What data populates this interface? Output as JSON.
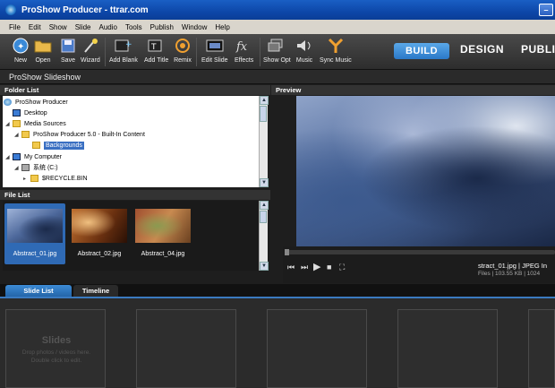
{
  "window": {
    "title": "ProShow Producer - ttrar.com"
  },
  "menu": [
    "File",
    "Edit",
    "Show",
    "Slide",
    "Audio",
    "Tools",
    "Publish",
    "Window",
    "Help"
  ],
  "toolbar": [
    {
      "label": "New",
      "icon": "new-icon"
    },
    {
      "label": "Open",
      "icon": "open-folder-icon"
    },
    {
      "label": "Save",
      "icon": "save-icon"
    },
    {
      "label": "Wizard",
      "icon": "wizard-icon"
    },
    {
      "label": "Add Blank",
      "icon": "add-blank-icon"
    },
    {
      "label": "Add Title",
      "icon": "add-title-icon"
    },
    {
      "label": "Remix",
      "icon": "remix-icon"
    },
    {
      "label": "Edit Slide",
      "icon": "edit-slide-icon"
    },
    {
      "label": "Effects",
      "icon": "effects-icon"
    },
    {
      "label": "Show Opt",
      "icon": "show-options-icon"
    },
    {
      "label": "Music",
      "icon": "music-icon"
    },
    {
      "label": "Sync Music",
      "icon": "sync-music-icon"
    }
  ],
  "modes": {
    "build": "BUILD",
    "design": "DESIGN",
    "publish": "PUBLIS"
  },
  "project": {
    "name": "ProShow Slideshow"
  },
  "folder_list": {
    "header": "Folder List",
    "items": [
      {
        "label": "ProShow Producer",
        "icon": "globe-icon"
      },
      {
        "label": "Desktop",
        "icon": "desktop-icon"
      },
      {
        "label": "Media Sources",
        "icon": "media-sources-icon"
      },
      {
        "label": "ProShow Producer 5.0 - Built-In Content",
        "icon": "folder-icon"
      },
      {
        "label": "Backgrounds",
        "icon": "folder-icon",
        "selected": true
      },
      {
        "label": "My Computer",
        "icon": "computer-icon"
      },
      {
        "label": "系统 (C:)",
        "icon": "disk-icon"
      },
      {
        "label": "$RECYCLE.BIN",
        "icon": "folder-icon"
      }
    ]
  },
  "file_list": {
    "header": "File List",
    "files": [
      {
        "name": "Abstract_01.jpg",
        "selected": true
      },
      {
        "name": "Abstract_02.jpg",
        "selected": false
      },
      {
        "name": "Abstract_04.jpg",
        "selected": false
      }
    ]
  },
  "preview": {
    "header": "Preview",
    "file_name": "stract_01.jpg",
    "file_type": "JPEG In",
    "meta": "Files  |  103.55 KB  |  1024"
  },
  "bottom_tabs": [
    {
      "label": "Slide List",
      "active": true
    },
    {
      "label": "Timeline",
      "active": false
    }
  ],
  "slides": {
    "title": "Slides",
    "hint_line1": "Drop photos / videos here.",
    "hint_line2": "Double click to edit."
  }
}
